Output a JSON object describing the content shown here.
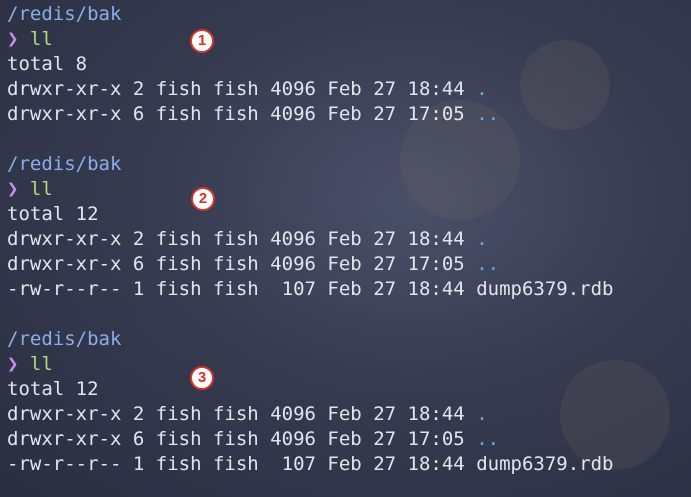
{
  "blocks": [
    {
      "path": "/redis/bak",
      "prompt": "❯",
      "command": "ll",
      "badge": "1",
      "total": "total 8",
      "rows": [
        {
          "perm": "drwxr-xr-x",
          "links": "2",
          "user": "fish",
          "group": "fish",
          "size": "4096",
          "month": "Feb",
          "day": "27",
          "time": "18:44",
          "name": "."
        },
        {
          "perm": "drwxr-xr-x",
          "links": "6",
          "user": "fish",
          "group": "fish",
          "size": "4096",
          "month": "Feb",
          "day": "27",
          "time": "17:05",
          "name": ".."
        }
      ]
    },
    {
      "path": "/redis/bak",
      "prompt": "❯",
      "command": "ll",
      "badge": "2",
      "total": "total 12",
      "rows": [
        {
          "perm": "drwxr-xr-x",
          "links": "2",
          "user": "fish",
          "group": "fish",
          "size": "4096",
          "month": "Feb",
          "day": "27",
          "time": "18:44",
          "name": "."
        },
        {
          "perm": "drwxr-xr-x",
          "links": "6",
          "user": "fish",
          "group": "fish",
          "size": "4096",
          "month": "Feb",
          "day": "27",
          "time": "17:05",
          "name": ".."
        },
        {
          "perm": "-rw-r--r--",
          "links": "1",
          "user": "fish",
          "group": "fish",
          "size": " 107",
          "month": "Feb",
          "day": "27",
          "time": "18:44",
          "name": "dump6379.rdb"
        }
      ]
    },
    {
      "path": "/redis/bak",
      "prompt": "❯",
      "command": "ll",
      "badge": "3",
      "total": "total 12",
      "rows": [
        {
          "perm": "drwxr-xr-x",
          "links": "2",
          "user": "fish",
          "group": "fish",
          "size": "4096",
          "month": "Feb",
          "day": "27",
          "time": "18:44",
          "name": "."
        },
        {
          "perm": "drwxr-xr-x",
          "links": "6",
          "user": "fish",
          "group": "fish",
          "size": "4096",
          "month": "Feb",
          "day": "27",
          "time": "17:05",
          "name": ".."
        },
        {
          "perm": "-rw-r--r--",
          "links": "1",
          "user": "fish",
          "group": "fish",
          "size": " 107",
          "month": "Feb",
          "day": "27",
          "time": "18:44",
          "name": "dump6379.rdb"
        }
      ]
    }
  ],
  "colors": {
    "path": "#8aaee8",
    "prompt": "#c58ee8",
    "command": "#b5d67a",
    "dir": "#6aa8e6",
    "text": "#e3e5ee",
    "badge_border": "#d8332a"
  }
}
